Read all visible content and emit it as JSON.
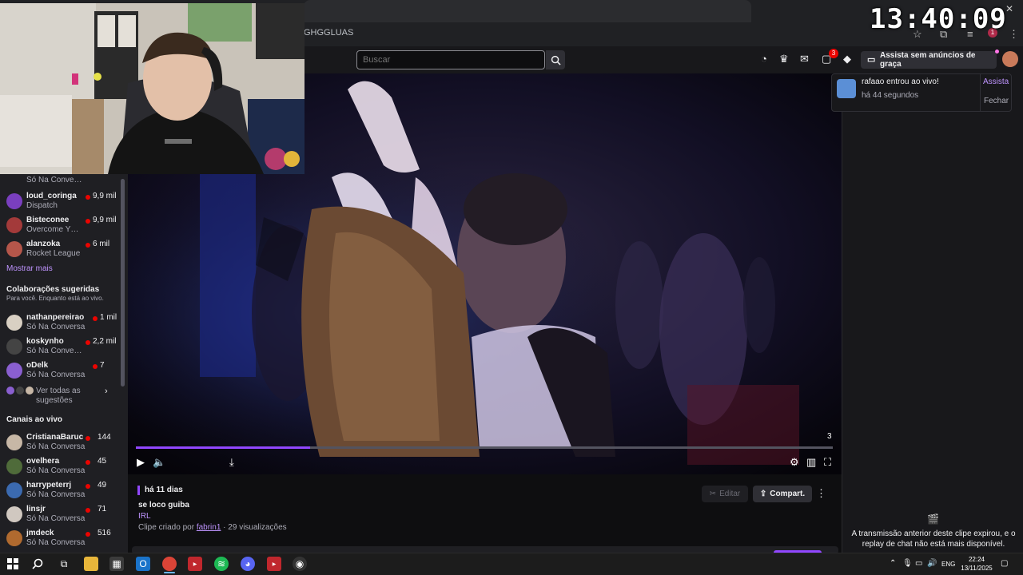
{
  "clock": "13:40:09",
  "browser": {
    "address_fragment": "GHGGLUAS"
  },
  "twitch_nav": {
    "search_placeholder": "Buscar",
    "notification_count": "3",
    "adfree_label": "Assista sem anúncios de graça",
    "icons": [
      "prime-icon",
      "crown-icon",
      "inbox-icon",
      "notifications-icon",
      "bits-icon"
    ]
  },
  "sidebar": {
    "top_partial": {
      "game": "Só Na Conve…"
    },
    "followed": [
      {
        "name": "loud_coringa",
        "game": "Dispatch",
        "viewers": "9,9 mil",
        "color": "#7a3fbf"
      },
      {
        "name": "Bisteconee",
        "game": "Overcome Y…",
        "viewers": "9,9 mil",
        "color": "#a33a3a"
      },
      {
        "name": "alanzoka",
        "game": "Rocket League",
        "viewers": "6 mil",
        "color": "#b5564a"
      }
    ],
    "show_more": "Mostrar mais",
    "collab_heading": "Colaborações sugeridas",
    "collab_sub": "Para você. Enquanto está ao vivo.",
    "collabs": [
      {
        "name": "nathanpereirao",
        "game": "Só Na Conversa",
        "viewers": "1 mil",
        "color": "#d9d0c3"
      },
      {
        "name": "koskynho",
        "game": "Só Na Conve…",
        "viewers": "2,2 mil",
        "color": "#444444"
      },
      {
        "name": "oDelk",
        "game": "Só Na Conversa",
        "viewers": "7",
        "color": "#8a5fd0"
      }
    ],
    "see_all": "Ver todas as sugestões",
    "live_heading": "Canais ao vivo",
    "live": [
      {
        "name": "CristianaBaruc",
        "game": "Só Na Conversa",
        "viewers": "144",
        "color": "#c7b7a6"
      },
      {
        "name": "ovelhera",
        "game": "Só Na Conversa",
        "viewers": "45",
        "color": "#4f6b3a"
      },
      {
        "name": "harrypeterrj",
        "game": "Só Na Conversa",
        "viewers": "49",
        "color": "#3b6ab0"
      },
      {
        "name": "linsjr",
        "game": "Só Na Conversa",
        "viewers": "71",
        "color": "#d0c8c0"
      },
      {
        "name": "jmdeck",
        "game": "Só Na Conversa",
        "viewers": "516",
        "color": "#b06a2f"
      }
    ]
  },
  "player": {
    "progress": 0.25,
    "chapter_number": "3",
    "icons": [
      "play-icon",
      "volume-icon",
      "download-icon",
      "settings-icon",
      "theatre-mode-icon",
      "fullscreen-icon"
    ]
  },
  "clip": {
    "age": "há 11 dias",
    "title": "se loco guiba",
    "category": "IRL",
    "created_prefix": "Clipe criado por",
    "creator": "fabrin1",
    "views": " · 29 visualizações",
    "edit_label": "Editar",
    "share_label": "Compart."
  },
  "toast": {
    "title": "rafaao entrou ao vivo!",
    "time": "há 44 segundos",
    "watch": "Assista",
    "close": "Fechar"
  },
  "chat": {
    "message": "A transmissão anterior deste clipe expirou, e o replay de chat não está mais disponível."
  },
  "taskbar": {
    "lang": "ENG",
    "time": "22:24",
    "date": "13/11/2025"
  },
  "colors": {
    "accent": "#9147ff",
    "live_red": "#eb0400",
    "link": "#bf94ff"
  }
}
